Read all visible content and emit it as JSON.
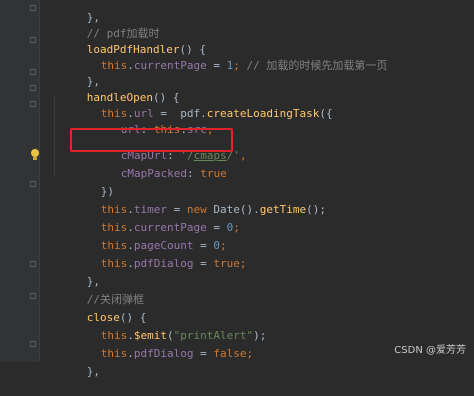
{
  "colors": {
    "background": "#2b2b2b",
    "gutter": "#313335",
    "keyword": "#cc7832",
    "function": "#ffc66d",
    "number": "#6897bb",
    "string": "#6a8759",
    "property": "#9876aa",
    "comment": "#808080",
    "plain": "#a9b7c6",
    "highlight_border": "#e0242a"
  },
  "code": {
    "l0": {
      "a": "},"
    },
    "l1": {
      "a": "// pdf加载时"
    },
    "l2": {
      "a": "loadPdfHandler",
      "b": "() {"
    },
    "l3": {
      "a": "this",
      "b": ".",
      "c": "currentPage",
      "d": " = ",
      "e": "1",
      "f": "; ",
      "g": "// 加载的时候先加载第一页"
    },
    "l4": {
      "a": "},"
    },
    "l5": {
      "a": "handleOpen",
      "b": "() {"
    },
    "l6": {
      "a": "this",
      "b": ".",
      "c": "url",
      "d": " =  ",
      "e": "pdf",
      "f": ".",
      "g": "createLoadingTask",
      "h": "({"
    },
    "l7": {
      "a": "url",
      "b": ": ",
      "c": "this",
      "d": ".",
      "e": "src",
      "f": ","
    },
    "l8": {
      "a": "cMapUrl",
      "b": ": ",
      "c": "'/",
      "d": "cmaps",
      "e": "/'",
      "f": ","
    },
    "l9": {
      "a": "cMapPacked",
      "b": ": ",
      "c": "true"
    },
    "l10": {
      "a": "})"
    },
    "l11": {
      "a": "this",
      "b": ".",
      "c": "timer",
      "d": " = ",
      "e": "new ",
      "f": "Date",
      "g": "().",
      "h": "getTime",
      "i": "();"
    },
    "l12": {
      "a": "this",
      "b": ".",
      "c": "currentPage",
      "d": " = ",
      "e": "0",
      "f": ";"
    },
    "l13": {
      "a": "this",
      "b": ".",
      "c": "pageCount",
      "d": " = ",
      "e": "0",
      "f": ";"
    },
    "l14": {
      "a": "this",
      "b": ".",
      "c": "pdfDialog",
      "d": " = ",
      "e": "true",
      "f": ";"
    },
    "l15": {
      "a": "},"
    },
    "l16": {
      "a": "//关闭弹框"
    },
    "l17": {
      "a": "close",
      "b": "() {"
    },
    "l18": {
      "a": "this",
      "b": ".",
      "c": "$emit",
      "d": "(",
      "e": "\"printAlert\"",
      "f": ");"
    },
    "l19": {
      "a": "this",
      "b": ".",
      "c": "pdfDialog",
      "d": " = ",
      "e": "false",
      "f": ";"
    },
    "l20": {
      "a": "},"
    }
  },
  "watermark": "CSDN @爱芳芳"
}
